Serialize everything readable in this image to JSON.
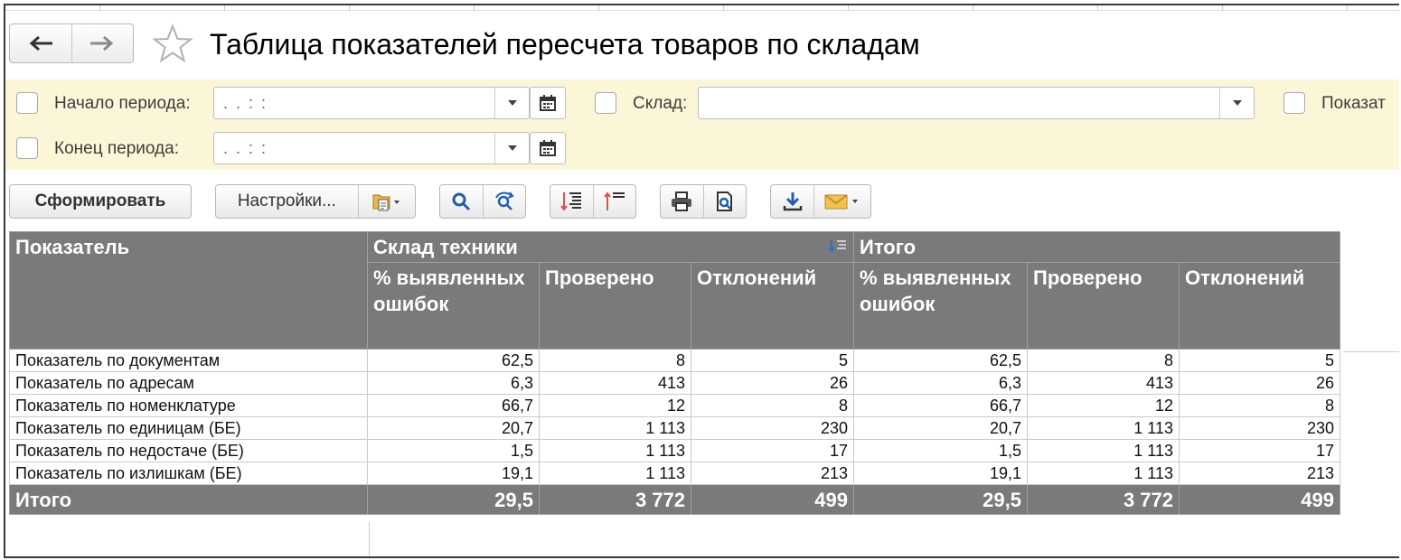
{
  "header": {
    "title": "Таблица показателей пересчета товаров по складам"
  },
  "filters": {
    "start_label": "Начало периода:",
    "start_value": ". .   : :",
    "end_label": "Конец периода:",
    "end_value": ". .   : :",
    "warehouse_label": "Склад:",
    "warehouse_value": "",
    "indicator_label": "Показат"
  },
  "toolbar": {
    "generate_label": "Сформировать",
    "settings_label": "Настройки..."
  },
  "table": {
    "col_indicator": "Показатель",
    "group_warehouse": "Склад техники",
    "group_total": "Итого",
    "sub_percent": "% выявленных ошибок",
    "sub_checked": "Проверено",
    "sub_deviations": "Отклонений",
    "rows": [
      {
        "name": "Показатель по документам",
        "p1": "62,5",
        "c1": "8",
        "d1": "5",
        "p2": "62,5",
        "c2": "8",
        "d2": "5"
      },
      {
        "name": "Показатель по адресам",
        "p1": "6,3",
        "c1": "413",
        "d1": "26",
        "p2": "6,3",
        "c2": "413",
        "d2": "26"
      },
      {
        "name": "Показатель по номенклатуре",
        "p1": "66,7",
        "c1": "12",
        "d1": "8",
        "p2": "66,7",
        "c2": "12",
        "d2": "8"
      },
      {
        "name": "Показатель по единицам (БЕ)",
        "p1": "20,7",
        "c1": "1 113",
        "d1": "230",
        "p2": "20,7",
        "c2": "1 113",
        "d2": "230"
      },
      {
        "name": "Показатель по недостаче (БЕ)",
        "p1": "1,5",
        "c1": "1 113",
        "d1": "17",
        "p2": "1,5",
        "c2": "1 113",
        "d2": "17"
      },
      {
        "name": "Показатель по излишкам (БЕ)",
        "p1": "19,1",
        "c1": "1 113",
        "d1": "213",
        "p2": "19,1",
        "c2": "1 113",
        "d2": "213"
      }
    ],
    "total": {
      "name": "Итого",
      "p1": "29,5",
      "c1": "3 772",
      "d1": "499",
      "p2": "29,5",
      "c2": "3 772",
      "d2": "499"
    }
  }
}
